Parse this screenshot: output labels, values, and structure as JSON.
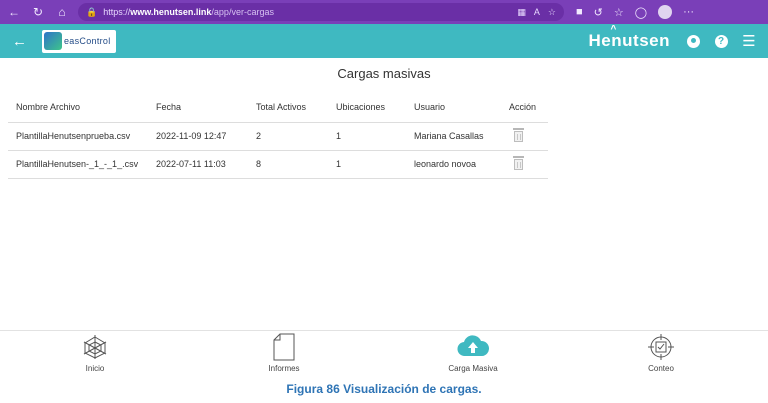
{
  "browser": {
    "url_prefix": "https://",
    "url_host": "www.henutsen.link",
    "url_path": "/app/ver-cargas",
    "more_label": "···"
  },
  "header": {
    "client_logo_text": "easControl",
    "brand": "Henutsen",
    "color": "#3fb9c1"
  },
  "page": {
    "title": "Cargas masivas"
  },
  "table": {
    "columns": [
      "Nombre Archivo",
      "Fecha",
      "Total Activos",
      "Ubicaciones",
      "Usuario",
      "Acción"
    ],
    "rows": [
      [
        "PlantillaHenutsenprueba.csv",
        "2022-11-09 12:47",
        "2",
        "1",
        "Mariana Casallas"
      ],
      [
        "PlantillaHenutsen-_1_-_1_.csv",
        "2022-07-11 11:03",
        "8",
        "1",
        "leonardo novoa"
      ]
    ]
  },
  "nav": {
    "items": [
      {
        "label": "Inicio",
        "icon": "radar-icon"
      },
      {
        "label": "Informes",
        "icon": "document-icon"
      },
      {
        "label": "Carga Masiva",
        "icon": "cloud-upload-icon"
      },
      {
        "label": "Conteo",
        "icon": "target-check-icon"
      }
    ]
  },
  "caption": "Figura 86 Visualización de cargas."
}
